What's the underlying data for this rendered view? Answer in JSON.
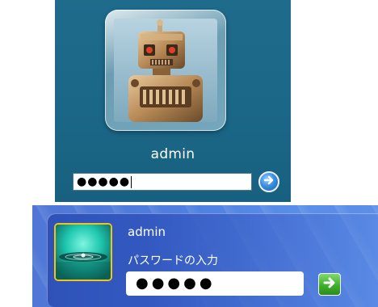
{
  "vista_logon": {
    "username": "admin",
    "password_mask": "●●●●●",
    "avatar_icon": "robot-picture",
    "submit_icon": "arrow-right-circle-icon",
    "colors": {
      "background": "#1f6b8c",
      "button": "#3d8fe0"
    }
  },
  "xp_logon": {
    "username": "admin",
    "password_prompt": "パスワードの入力",
    "password_mask": "●●●●●",
    "avatar_icon": "water-drop-picture",
    "submit_icon": "green-arrow-icon",
    "colors": {
      "background": "#4f7fe0",
      "avatar_border": "#f2c418",
      "button": "#3fb12a"
    }
  }
}
